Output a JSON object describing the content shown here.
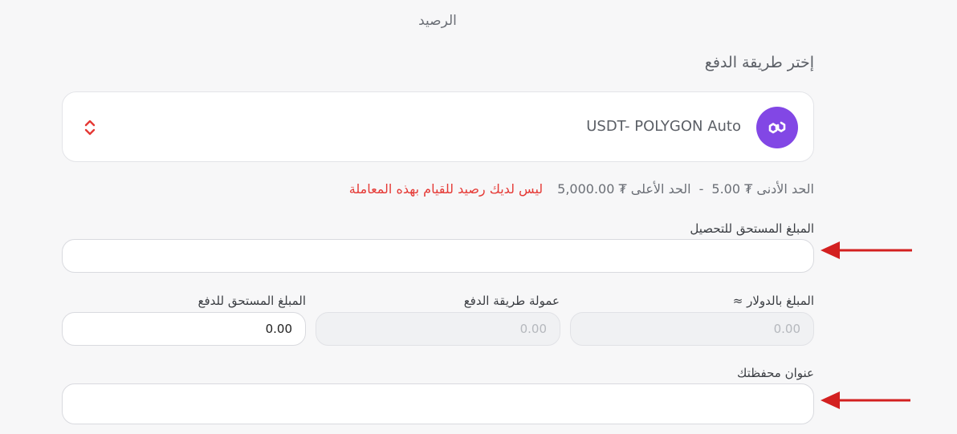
{
  "header": {
    "balance_label": "الرصيد"
  },
  "payment": {
    "section_title": "إختر طريقة الدفع",
    "selected_method": "USDT- POLYGON Auto",
    "icons": {
      "logo": "polygon-logo-icon",
      "arrows": "select-arrows-icon"
    },
    "brand_color": "#8247e5"
  },
  "limits": {
    "min_text": "الحد الأدنى ₮ 5.00",
    "separator": "-",
    "max_text": "الحد الأعلى ₮ 5,000.00",
    "error": "ليس لديك رصيد للقيام بهذه المعاملة",
    "error_color": "#e53935"
  },
  "form": {
    "amount_due": {
      "label": "المبلغ المستحق للتحصيل",
      "value": ""
    },
    "usd_amount": {
      "label": "المبلغ بالدولار ≈",
      "value": "0.00"
    },
    "fee": {
      "label": "عمولة طريقة الدفع",
      "value": "0.00"
    },
    "payable": {
      "label": "المبلغ المستحق للدفع",
      "value": "0.00"
    },
    "wallet": {
      "label": "عنوان محفظتك",
      "value": ""
    }
  },
  "annotations": {
    "arrow_color": "#d32020"
  }
}
